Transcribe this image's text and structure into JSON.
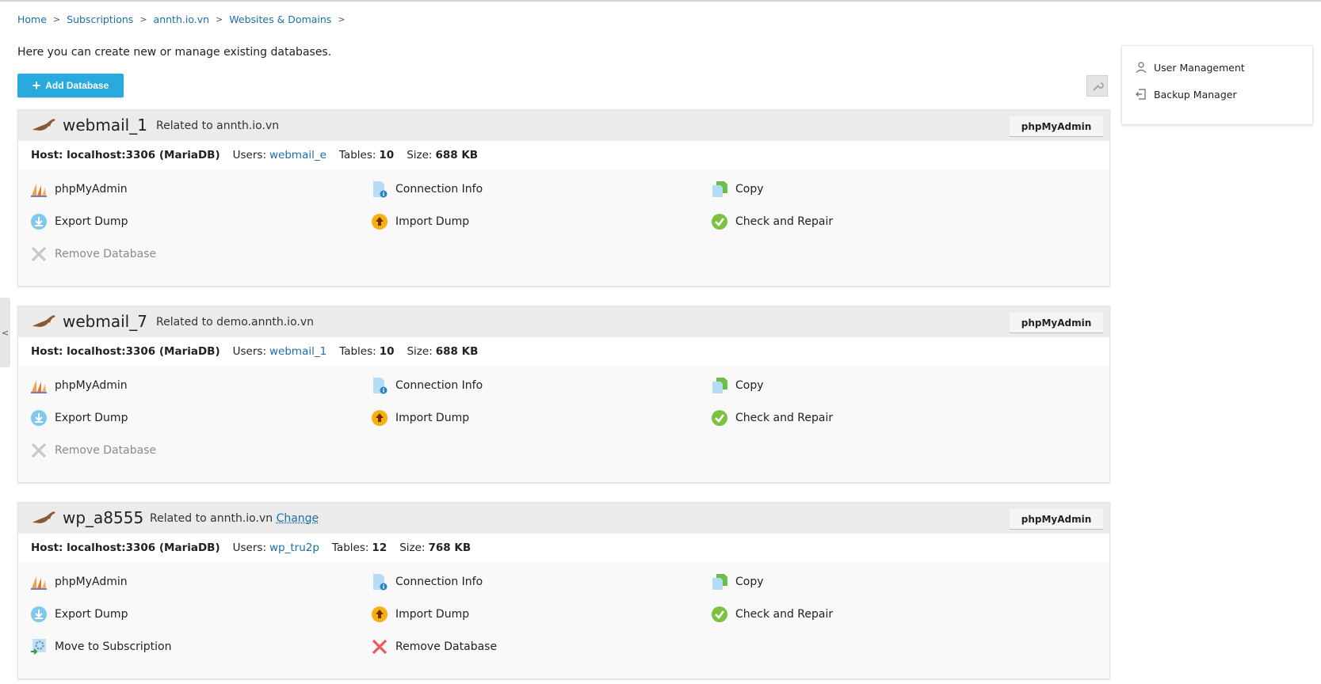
{
  "breadcrumb": [
    "Home",
    "Subscriptions",
    "annth.io.vn",
    "Websites & Domains"
  ],
  "intro_text": "Here you can create new or manage existing databases.",
  "add_button": "Add Database",
  "right_panel": {
    "user_management": "User Management",
    "backup_manager": "Backup Manager"
  },
  "labels": {
    "host_prefix": "Host:",
    "users_prefix": "Users:",
    "tables_prefix": "Tables:",
    "size_prefix": "Size:",
    "related_prefix": "Related to",
    "change": "Change",
    "phpmyadmin_button": "phpMyAdmin"
  },
  "actions": {
    "phpmyadmin": "phpMyAdmin",
    "connection_info": "Connection Info",
    "copy": "Copy",
    "export_dump": "Export Dump",
    "import_dump": "Import Dump",
    "check_repair": "Check and Repair",
    "remove_database": "Remove Database",
    "move_subscription": "Move to Subscription"
  },
  "databases": [
    {
      "name": "webmail_1",
      "related": "annth.io.vn",
      "host": "localhost:3306 (MariaDB)",
      "user": "webmail_e",
      "tables": "10",
      "size": "688 KB"
    },
    {
      "name": "webmail_7",
      "related": "demo.annth.io.vn",
      "host": "localhost:3306 (MariaDB)",
      "user": "webmail_1",
      "tables": "10",
      "size": "688 KB"
    },
    {
      "name": "wp_a8555",
      "related": "annth.io.vn",
      "host": "localhost:3306 (MariaDB)",
      "user": "wp_tru2p",
      "tables": "12",
      "size": "768 KB"
    }
  ]
}
